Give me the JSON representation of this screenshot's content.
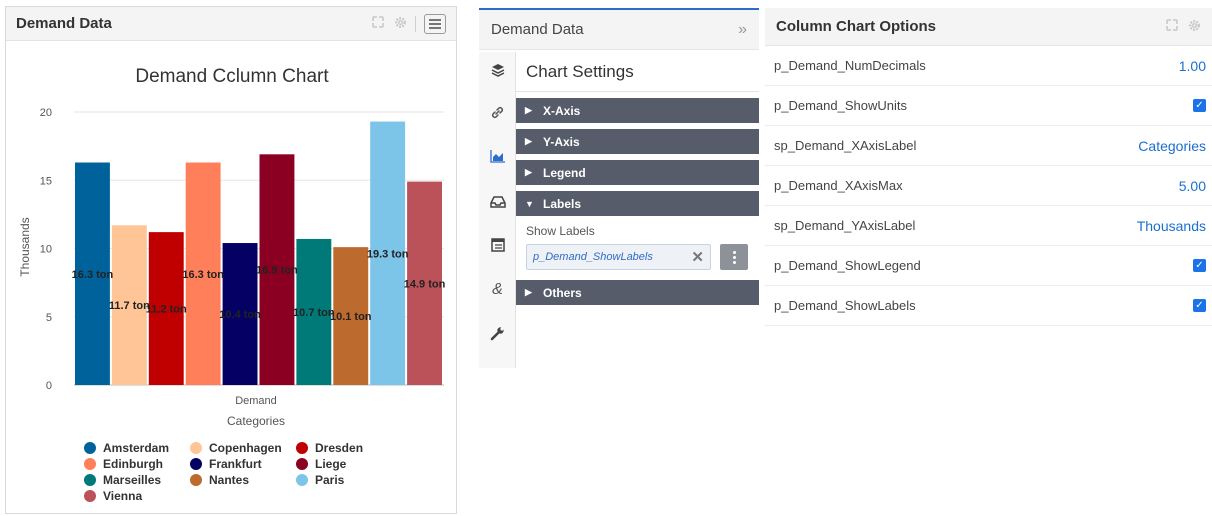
{
  "left_widget": {
    "title": "Demand Data"
  },
  "chart_data": {
    "type": "bar",
    "title": "Demand Cclumn Chart",
    "xlabel": "Categories",
    "ylabel": "Thousands",
    "group_label": "Demand",
    "ylim": [
      0,
      20
    ],
    "yticks": [
      "0",
      "5",
      "10",
      "15",
      "20"
    ],
    "series": [
      {
        "name": "Amsterdam",
        "value": 16.3,
        "label": "16.3 ton",
        "color": "#00629b"
      },
      {
        "name": "Copenhagen",
        "value": 11.7,
        "label": "11.7 ton",
        "color": "#ffc596"
      },
      {
        "name": "Dresden",
        "value": 11.2,
        "label": "11.2 ton",
        "color": "#c00000"
      },
      {
        "name": "Edinburgh",
        "value": 16.3,
        "label": "16.3 ton",
        "color": "#ff7f5a"
      },
      {
        "name": "Frankfurt",
        "value": 10.4,
        "label": "10.4 ton",
        "color": "#050064"
      },
      {
        "name": "Liege",
        "value": 16.9,
        "label": "16.9 ton",
        "color": "#8b0022"
      },
      {
        "name": "Marseilles",
        "value": 10.7,
        "label": "10.7 ton",
        "color": "#007a78"
      },
      {
        "name": "Nantes",
        "value": 10.1,
        "label": "10.1 ton",
        "color": "#bd6a2e"
      },
      {
        "name": "Paris",
        "value": 19.3,
        "label": "19.3 ton",
        "color": "#7cc4e8"
      },
      {
        "name": "Vienna",
        "value": 14.9,
        "label": "14.9 ton",
        "color": "#bb5159"
      }
    ],
    "grid": true,
    "legend": "bottom"
  },
  "middle_panel": {
    "title": "Demand Data",
    "settings_title": "Chart Settings",
    "rail_icons": [
      "layers-icon",
      "link-icon",
      "area-chart-icon",
      "inbox-icon",
      "table-icon",
      "ampersand-icon",
      "wrench-icon"
    ],
    "sections": [
      {
        "label": "X-Axis",
        "expanded": false
      },
      {
        "label": "Y-Axis",
        "expanded": false
      },
      {
        "label": "Legend",
        "expanded": false
      },
      {
        "label": "Labels",
        "expanded": true
      }
    ],
    "show_labels_label": "Show Labels",
    "show_labels_value": "p_Demand_ShowLabels",
    "others_label": "Others"
  },
  "right_panel": {
    "title": "Column Chart Options",
    "options": [
      {
        "label": "p_Demand_NumDecimals",
        "value": "1.00",
        "kind": "text"
      },
      {
        "label": "p_Demand_ShowUnits",
        "checked": true,
        "kind": "check"
      },
      {
        "label": "sp_Demand_XAxisLabel",
        "value": "Categories",
        "kind": "text"
      },
      {
        "label": "p_Demand_XAxisMax",
        "value": "5.00",
        "kind": "text"
      },
      {
        "label": "sp_Demand_YAxisLabel",
        "value": "Thousands",
        "kind": "text"
      },
      {
        "label": "p_Demand_ShowLegend",
        "checked": true,
        "kind": "check"
      },
      {
        "label": "p_Demand_ShowLabels",
        "checked": true,
        "kind": "check"
      }
    ]
  }
}
